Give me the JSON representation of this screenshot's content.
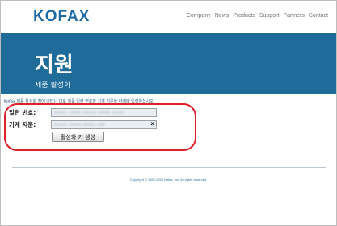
{
  "header": {
    "logo_text": "KOFAX",
    "nav": [
      "Company",
      "News",
      "Products",
      "Support",
      "Partners",
      "Contact"
    ]
  },
  "hero": {
    "title": "지원",
    "subtitle": "제품 활성화"
  },
  "instructions": "Kofax 제품 활성화 창에 나타난 대로 제품 일련 번호와 기계 지문을 아래에 입력하십시오.",
  "form": {
    "serial_label": "일련 번호:",
    "serial_value": "XXXX2-XXXXX-XXXXX-XXXXX-XXXXX",
    "fingerprint_label": "기계 지문:",
    "fingerprint_value": "XXXXX-XXXXX-XXXXX-XXX",
    "clear_symbol": "×",
    "activate_label": "활성화 키 생성"
  },
  "footer": {
    "copyright": "Copyright © 1992-2020 Kofax, Inc. All rights reserved."
  },
  "colors": {
    "brand_blue": "#1b6aa6",
    "hero_bg": "#1f6c9a",
    "highlight_red": "#e0202a"
  }
}
